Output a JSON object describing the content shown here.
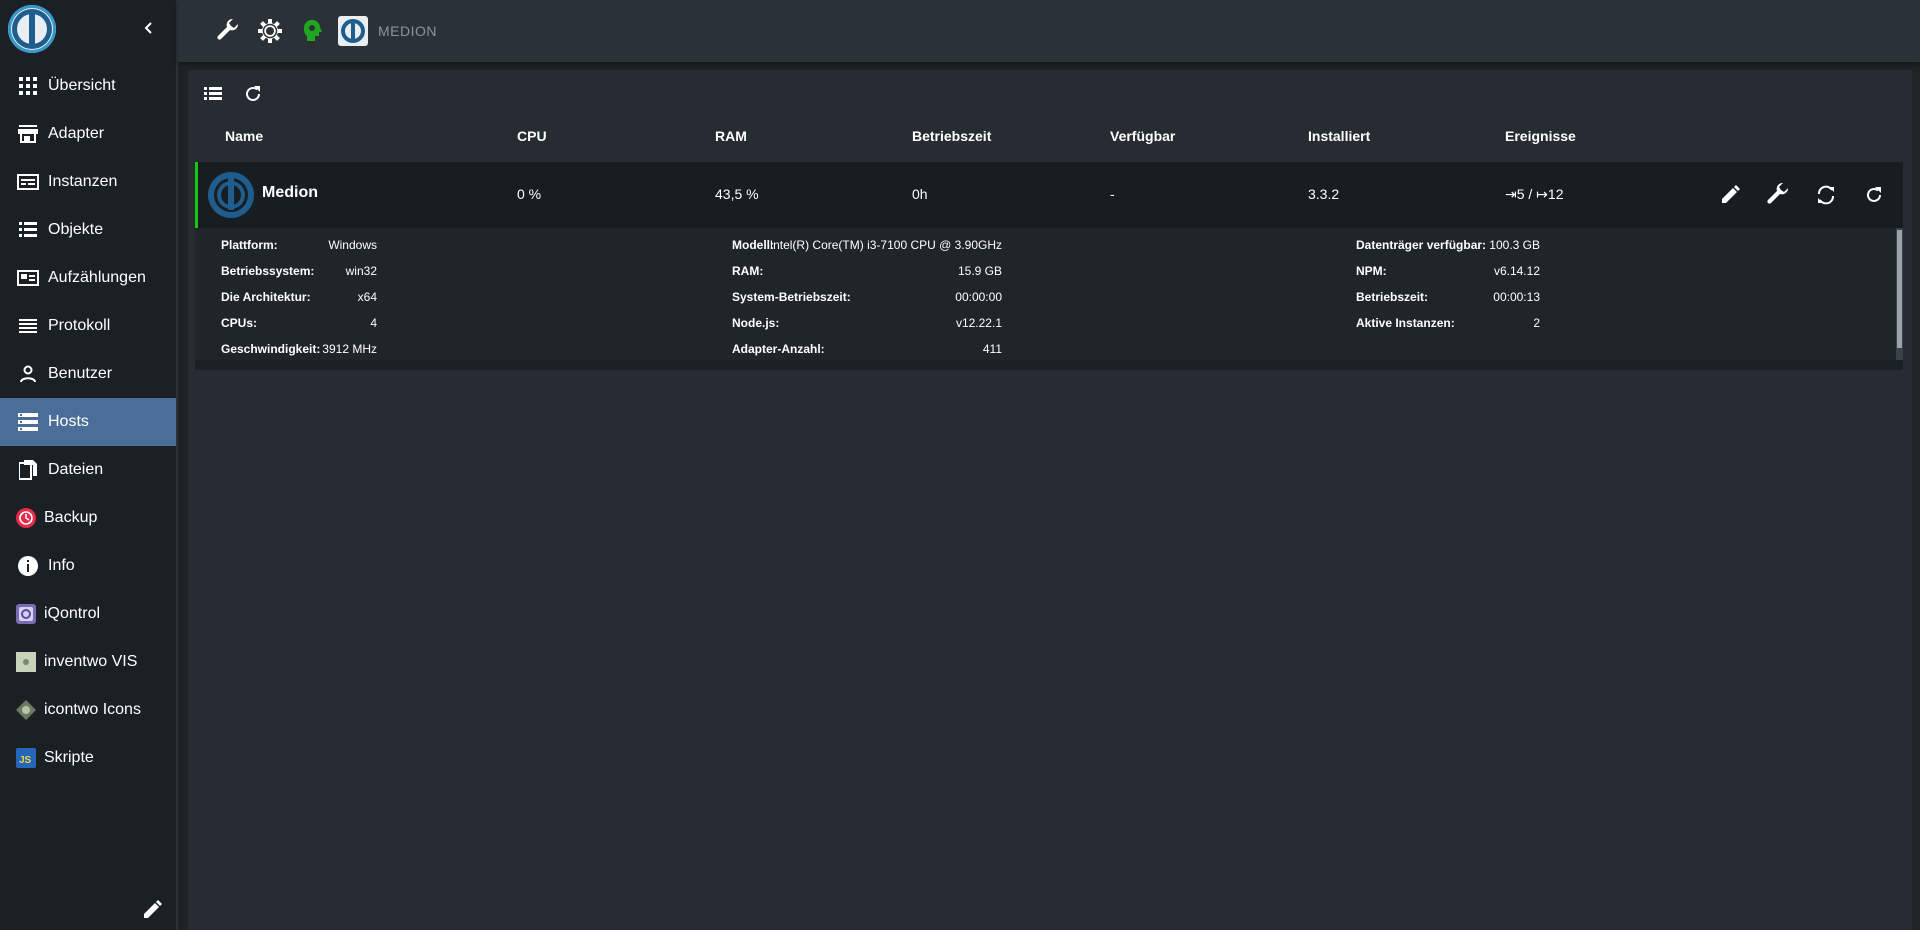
{
  "sidebar": {
    "items": [
      {
        "label": "Übersicht",
        "icon": "grid-icon"
      },
      {
        "label": "Adapter",
        "icon": "store-icon"
      },
      {
        "label": "Instanzen",
        "icon": "instances-icon"
      },
      {
        "label": "Objekte",
        "icon": "list-icon"
      },
      {
        "label": "Aufzählungen",
        "icon": "enum-icon"
      },
      {
        "label": "Protokoll",
        "icon": "lines-icon"
      },
      {
        "label": "Benutzer",
        "icon": "user-icon"
      },
      {
        "label": "Hosts",
        "icon": "storage-icon"
      },
      {
        "label": "Dateien",
        "icon": "files-icon"
      },
      {
        "label": "Backup",
        "icon": "backup-icon"
      },
      {
        "label": "Info",
        "icon": "info-icon"
      },
      {
        "label": "iQontrol",
        "icon": "iqontrol-icon"
      },
      {
        "label": "inventwo VIS",
        "icon": "inventwo-icon"
      },
      {
        "label": "icontwo Icons",
        "icon": "icontwo-icon"
      },
      {
        "label": "Skripte",
        "icon": "javascript-icon"
      }
    ],
    "active": "Hosts"
  },
  "header": {
    "host_name": "MEDION"
  },
  "table": {
    "headers": {
      "name": "Name",
      "cpu": "CPU",
      "ram": "RAM",
      "uptime": "Betriebszeit",
      "available": "Verfügbar",
      "installed": "Installiert",
      "events": "Ereignisse"
    },
    "row": {
      "name": "Medion",
      "cpu": "0 %",
      "ram": "43,5 %",
      "uptime": "0h",
      "available": "-",
      "installed": "3.3.2",
      "events": "⇥5 / ↦12"
    }
  },
  "details": {
    "col1": [
      {
        "label": "Plattform:",
        "value": "Windows"
      },
      {
        "label": "Betriebssystem:",
        "value": "win32"
      },
      {
        "label": "Die Architektur:",
        "value": "x64"
      },
      {
        "label": "CPUs:",
        "value": "4"
      },
      {
        "label": "Geschwindigkeit:",
        "value": "3912 MHz"
      }
    ],
    "col2": [
      {
        "label": "Modell:",
        "value": "Intel(R) Core(TM) i3-7100 CPU @ 3.90GHz"
      },
      {
        "label": "RAM:",
        "value": "15.9 GB"
      },
      {
        "label": "System-Betriebszeit:",
        "value": "00:00:00"
      },
      {
        "label": "Node.js:",
        "value": "v12.22.1"
      },
      {
        "label": "Adapter-Anzahl:",
        "value": "411"
      }
    ],
    "col3": [
      {
        "label": "Datenträger verfügbar:",
        "value": "100.3 GB"
      },
      {
        "label": "NPM:",
        "value": "v6.14.12"
      },
      {
        "label": "Betriebszeit:",
        "value": "00:00:13"
      },
      {
        "label": "Aktive Instanzen:",
        "value": "2"
      }
    ]
  },
  "colors": {
    "accent_active": "#4a6e98",
    "status_green": "#11c911",
    "host_icon_green": "#1fa51f",
    "backup_red": "#e8294a"
  }
}
